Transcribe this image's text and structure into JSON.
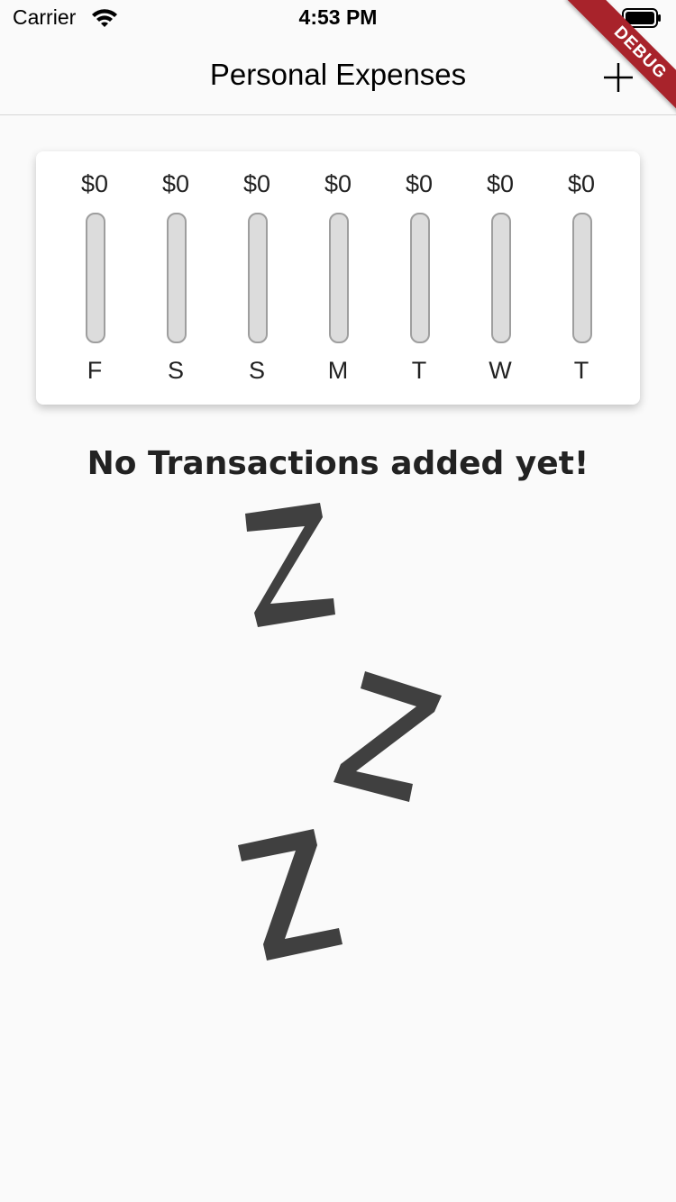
{
  "status_bar": {
    "carrier": "Carrier",
    "time": "4:53 PM",
    "wifi_icon": "wifi-icon",
    "battery_icon": "battery-icon"
  },
  "debug_banner": "DEBUG",
  "app_bar": {
    "title": "Personal Expenses",
    "add_icon": "plus-icon"
  },
  "chart_data": {
    "type": "bar",
    "categories": [
      "F",
      "S",
      "S",
      "M",
      "T",
      "W",
      "T"
    ],
    "values": [
      0,
      0,
      0,
      0,
      0,
      0,
      0
    ],
    "value_labels": [
      "$0",
      "$0",
      "$0",
      "$0",
      "$0",
      "$0",
      "$0"
    ],
    "title": "",
    "xlabel": "",
    "ylabel": "",
    "ylim": [
      0,
      1
    ],
    "grid": false
  },
  "empty_state": {
    "title": "No Transactions added yet!",
    "image": "sleeping-zzz-image"
  },
  "colors": {
    "background": "#fafafa",
    "bar_track": "#dcdcdc",
    "bar_border": "#9e9e9e",
    "zzz": "#404040",
    "debug_banner": "#a8232b"
  }
}
